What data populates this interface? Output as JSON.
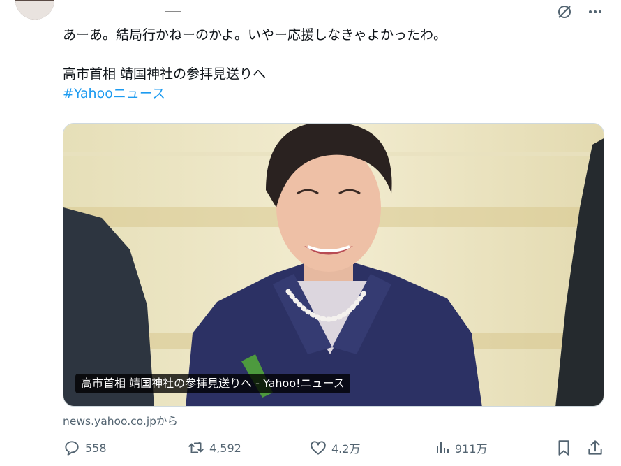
{
  "tweet": {
    "text_line1": "あーあ。結局行かねーのかよ。いやー応援しなきゃよかったわ。",
    "text_line2": "高市首相 靖国神社の参拝見送りへ",
    "hashtag": "#Yahooニュース"
  },
  "card": {
    "caption": "高市首相 靖国神社の参拝見送りへ - Yahoo!ニュース",
    "source": "news.yahoo.co.jpから"
  },
  "actions": {
    "replies": "558",
    "reposts": "4,592",
    "likes": "4.2万",
    "views": "911万"
  },
  "icons": {
    "top": [
      "grok-icon",
      "more-icon"
    ],
    "actions": [
      "reply-icon",
      "repost-icon",
      "like-icon",
      "views-icon",
      "bookmark-icon",
      "share-icon"
    ]
  },
  "colors": {
    "text": "#0f1419",
    "secondary": "#536471",
    "link": "#1d9bf0"
  }
}
